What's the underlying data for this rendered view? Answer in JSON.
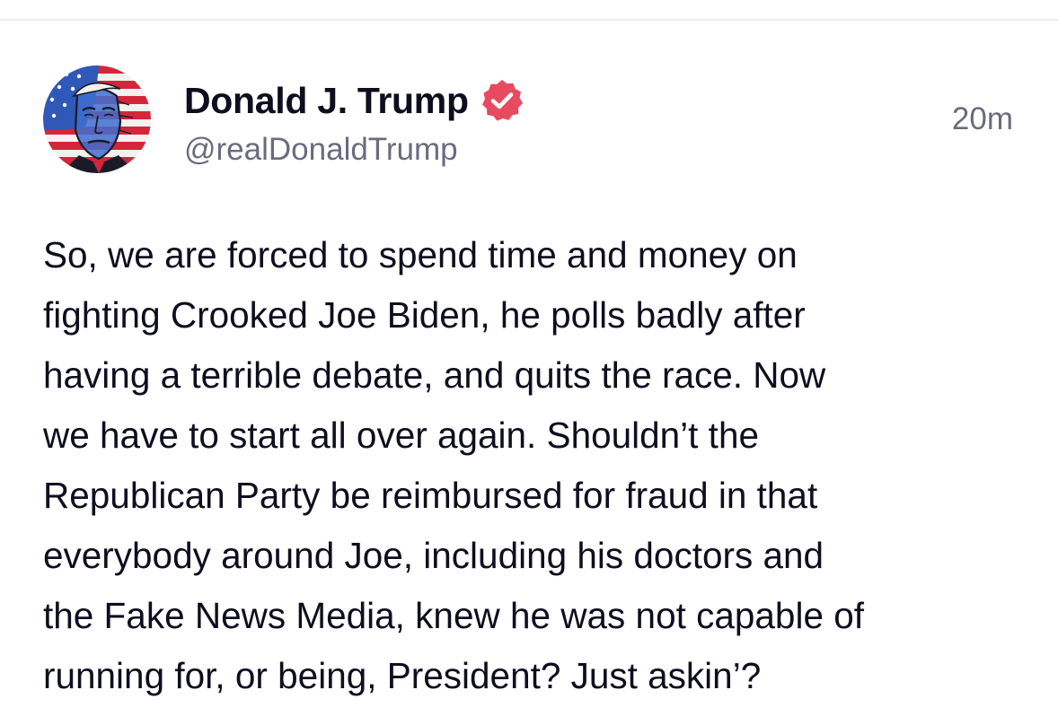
{
  "post": {
    "author": {
      "display_name": "Donald J. Trump",
      "handle": "@realDonaldTrump",
      "verified": true,
      "verified_icon": "verified-badge-icon",
      "avatar_icon": "avatar-flag-portrait"
    },
    "timestamp": "20m",
    "body_lines": [
      "So, we are forced to spend time and money on",
      "fighting Crooked Joe Biden, he polls badly after",
      "having a terrible debate, and quits the race. Now",
      "we have to start all over again. Shouldn’t the",
      "Republican Party be reimbursed for fraud in that",
      "everybody around Joe, including his doctors and",
      "the Fake News Media, knew he was not capable of",
      "running for, or being, President? Just askin’?"
    ]
  },
  "colors": {
    "text_primary": "#0e0e1f",
    "text_secondary": "#6b6b7e",
    "verified_badge": "#e84a5f",
    "divider": "#ececf0",
    "background": "#ffffff"
  }
}
